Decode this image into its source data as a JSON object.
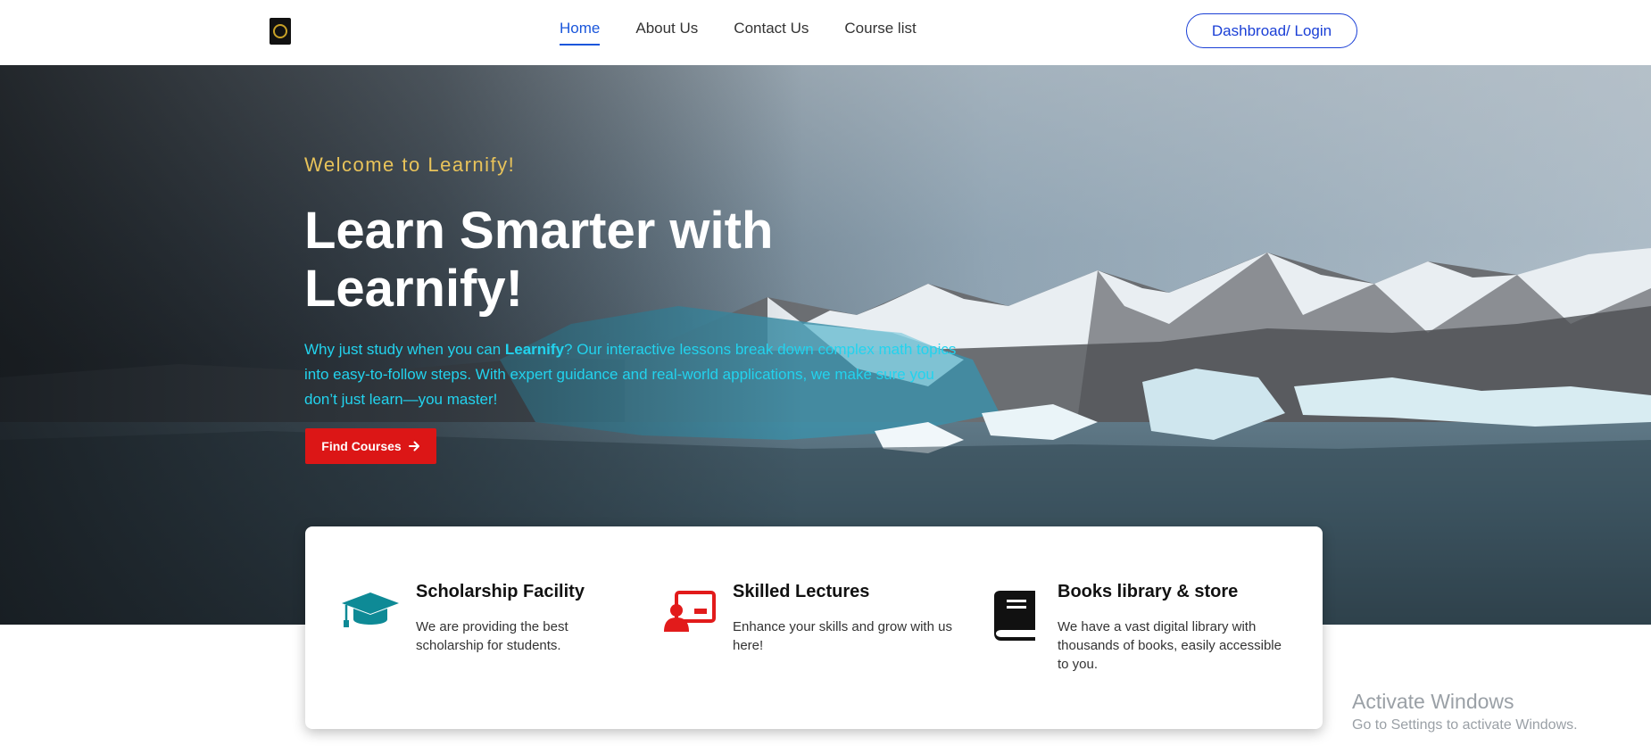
{
  "nav": {
    "links": [
      "Home",
      "About Us",
      "Contact Us",
      "Course list"
    ],
    "active": "Home",
    "login_label": "Dashbroad/ Login"
  },
  "hero": {
    "welcome": "Welcome to Learnify!",
    "headline": "Learn Smarter with Learnify!",
    "intro_before": "Why just study when you can ",
    "intro_brand": "Learnify",
    "intro_after": "? Our interactive lessons break down complex math topics into easy-to-follow steps. With expert guidance and real-world applications, we make sure you don’t just learn—you master!",
    "cta_label": "Find Courses"
  },
  "features": [
    {
      "title": "Scholarship Facility",
      "text": "We are providing the best scholarship for students.",
      "icon": "graduation-cap-icon",
      "color": "#0e8a96"
    },
    {
      "title": "Skilled Lectures",
      "text": "Enhance your skills and grow with us here!",
      "icon": "presentation-board-icon",
      "color": "#e21b1b"
    },
    {
      "title": "Books library & store",
      "text": "We have a vast digital library with thousands of books, easily accessible to you.",
      "icon": "book-icon",
      "color": "#111111"
    }
  ],
  "watermark": {
    "line1": "Activate Windows",
    "line2": "Go to Settings to activate Windows."
  },
  "colors": {
    "nav_active": "#1a56db",
    "welcome": "#e8c35a",
    "intro": "#22d3ee",
    "cta": "#dc1616"
  }
}
